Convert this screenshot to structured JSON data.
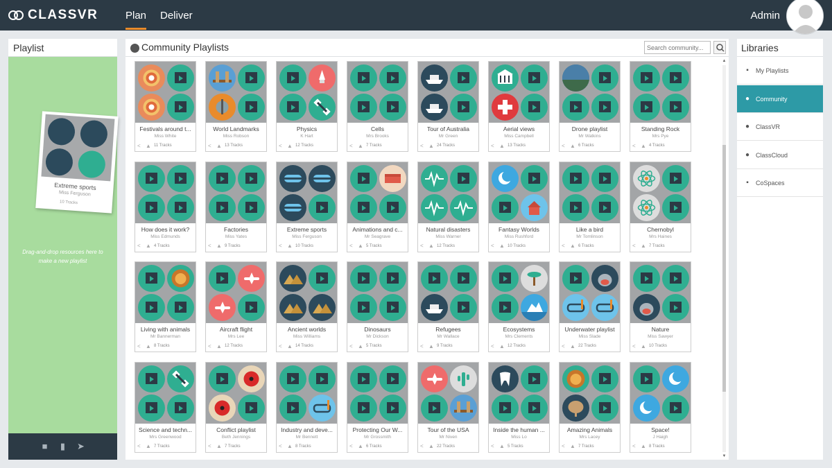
{
  "app": {
    "logo_text": "CLASSVR",
    "user_name": "Admin"
  },
  "nav": {
    "tabs": [
      {
        "label": "Plan",
        "active": true
      },
      {
        "label": "Deliver",
        "active": false
      }
    ]
  },
  "colors": {
    "topbar": "#2c3a45",
    "accent": "#e98b2b",
    "tile_teal": "#2fae91",
    "drop_green": "#a8dc9e",
    "library_active": "#2d9aa6"
  },
  "playlist_panel": {
    "title": "Playlist",
    "dragging_card": {
      "title": "Extreme sports",
      "author": "Miss Ferguson",
      "tracks": "10 Tracks"
    },
    "hint": "Drag-and-drop resources here to make a new playlist",
    "footer_icons": [
      "save-icon",
      "trash-icon",
      "send-icon"
    ]
  },
  "community": {
    "title": "Community Playlists",
    "search_placeholder": "Search community...",
    "playlists": [
      {
        "title": "Festivals around t...",
        "author": "Miss White",
        "tracks": "11 Tracks",
        "tiles": [
          "mandala",
          "video",
          "mandala",
          "video"
        ]
      },
      {
        "title": "World Landmarks",
        "author": "Miss Robson",
        "tracks": "13 Tracks",
        "tiles": [
          "bridge",
          "video",
          "mill",
          "video"
        ]
      },
      {
        "title": "Physics",
        "author": "K Hart",
        "tracks": "12 Tracks",
        "tiles": [
          "video",
          "rocket",
          "video",
          "satellite"
        ]
      },
      {
        "title": "Cells",
        "author": "Mrs Brooks",
        "tracks": "7 Tracks",
        "tiles": [
          "video",
          "video",
          "video",
          "video"
        ]
      },
      {
        "title": "Tour of Australia",
        "author": "Mr Green",
        "tracks": "24 Tracks",
        "tiles": [
          "ship",
          "video",
          "ship",
          "video"
        ]
      },
      {
        "title": "Aerial views",
        "author": "Miss Campbell",
        "tracks": "13 Tracks",
        "tiles": [
          "temple",
          "video",
          "redcross",
          "video"
        ]
      },
      {
        "title": "Drone playlist",
        "author": "Mr Watkins",
        "tracks": "6 Tracks",
        "tiles": [
          "photo",
          "video",
          "video",
          "video"
        ]
      },
      {
        "title": "Standing Rock",
        "author": "Mrs Pye",
        "tracks": "4 Tracks",
        "tiles": [
          "video",
          "video",
          "video",
          "video"
        ]
      },
      {
        "title": "How does it work?",
        "author": "Miss Edmunds",
        "tracks": "4 Tracks",
        "tiles": [
          "video",
          "video",
          "video",
          "video"
        ]
      },
      {
        "title": "Factories",
        "author": "Miss Yates",
        "tracks": "9 Tracks",
        "tiles": [
          "video",
          "video",
          "video",
          "video"
        ]
      },
      {
        "title": "Extreme sports",
        "author": "Miss Ferguson",
        "tracks": "10 Tracks",
        "tiles": [
          "goggles",
          "goggles",
          "goggles",
          "video"
        ]
      },
      {
        "title": "Animations and c...",
        "author": "Mr Seagrave",
        "tracks": "5 Tracks",
        "tiles": [
          "video",
          "sofa",
          "video",
          "video"
        ]
      },
      {
        "title": "Natural disasters",
        "author": "Miss Warner",
        "tracks": "12 Tracks",
        "tiles": [
          "wave",
          "video",
          "wave",
          "wave"
        ]
      },
      {
        "title": "Fantasy Worlds",
        "author": "Miss Rushford",
        "tracks": "10 Tracks",
        "tiles": [
          "moon",
          "video",
          "video",
          "house"
        ]
      },
      {
        "title": "Like a bird",
        "author": "Mr Tomlinson",
        "tracks": "6 Tracks",
        "tiles": [
          "video",
          "video",
          "video",
          "video"
        ]
      },
      {
        "title": "Chernobyl",
        "author": "Mrs Haines",
        "tracks": "7 Tracks",
        "tiles": [
          "atom",
          "video",
          "atom",
          "video"
        ]
      },
      {
        "title": "Living with animals",
        "author": "Mr Bannerman",
        "tracks": "8 Tracks",
        "tiles": [
          "video",
          "lion",
          "video",
          "video"
        ]
      },
      {
        "title": "Aircraft flight",
        "author": "Mrs Lee",
        "tracks": "12 Tracks",
        "tiles": [
          "video",
          "plane",
          "plane",
          "video"
        ]
      },
      {
        "title": "Ancient worlds",
        "author": "Miss Williams",
        "tracks": "14 Tracks",
        "tiles": [
          "pyramid",
          "video",
          "pyramid",
          "pyramid"
        ]
      },
      {
        "title": "Dinosaurs",
        "author": "Mr Dickson",
        "tracks": "5 Tracks",
        "tiles": [
          "video",
          "video",
          "video",
          "video"
        ]
      },
      {
        "title": "Refugees",
        "author": "Mr Wallace",
        "tracks": "9 Tracks",
        "tiles": [
          "video",
          "video",
          "ship",
          "video"
        ]
      },
      {
        "title": "Ecosystems",
        "author": "Mrs Clements",
        "tracks": "12 Tracks",
        "tiles": [
          "video",
          "palm",
          "video",
          "iceberg"
        ]
      },
      {
        "title": "Underwater playlist",
        "author": "Miss Slade",
        "tracks": "22 Tracks",
        "tiles": [
          "video",
          "shark",
          "mask",
          "mask"
        ]
      },
      {
        "title": "Nature",
        "author": "Miss Sawyer",
        "tracks": "10 Tracks",
        "tiles": [
          "video",
          "video",
          "shark",
          "video"
        ]
      },
      {
        "title": "Science and techn...",
        "author": "Mrs Greenwood",
        "tracks": "7 Tracks",
        "tiles": [
          "video",
          "satellite",
          "video",
          "video"
        ]
      },
      {
        "title": "Conflict playlist",
        "author": "Beth Jennings",
        "tracks": "7 Tracks",
        "tiles": [
          "video",
          "poppy",
          "poppy",
          "video"
        ]
      },
      {
        "title": "Industry and deve...",
        "author": "Mr Bennett",
        "tracks": "8 Tracks",
        "tiles": [
          "video",
          "video",
          "video",
          "mask"
        ]
      },
      {
        "title": "Protecting Our W...",
        "author": "Mr Grossmith",
        "tracks": "6 Tracks",
        "tiles": [
          "video",
          "video",
          "video",
          "video"
        ]
      },
      {
        "title": "Tour of the USA",
        "author": "Mr Niven",
        "tracks": "22 Tracks",
        "tiles": [
          "plane",
          "cactus",
          "video",
          "bridge"
        ]
      },
      {
        "title": "Inside the human ...",
        "author": "Miss Lo",
        "tracks": "5 Tracks",
        "tiles": [
          "tooth",
          "video",
          "video",
          "video"
        ]
      },
      {
        "title": "Amazing Animals",
        "author": "Mrs Lacey",
        "tracks": "7 Tracks",
        "tiles": [
          "lion",
          "video",
          "elephant",
          "video"
        ]
      },
      {
        "title": "Space!",
        "author": "J Haigh",
        "tracks": "8 Tracks",
        "tiles": [
          "video",
          "moon",
          "moon",
          "video"
        ]
      }
    ]
  },
  "libraries": {
    "title": "Libraries",
    "items": [
      {
        "label": "My Playlists",
        "icon": "folder-icon",
        "active": false
      },
      {
        "label": "Community",
        "icon": "globe-icon",
        "active": true
      },
      {
        "label": "ClassVR",
        "icon": "classvr-icon",
        "active": false
      },
      {
        "label": "ClassCloud",
        "icon": "cloud-icon",
        "active": false
      },
      {
        "label": "CoSpaces",
        "icon": "cospaces-icon",
        "active": false
      }
    ]
  }
}
